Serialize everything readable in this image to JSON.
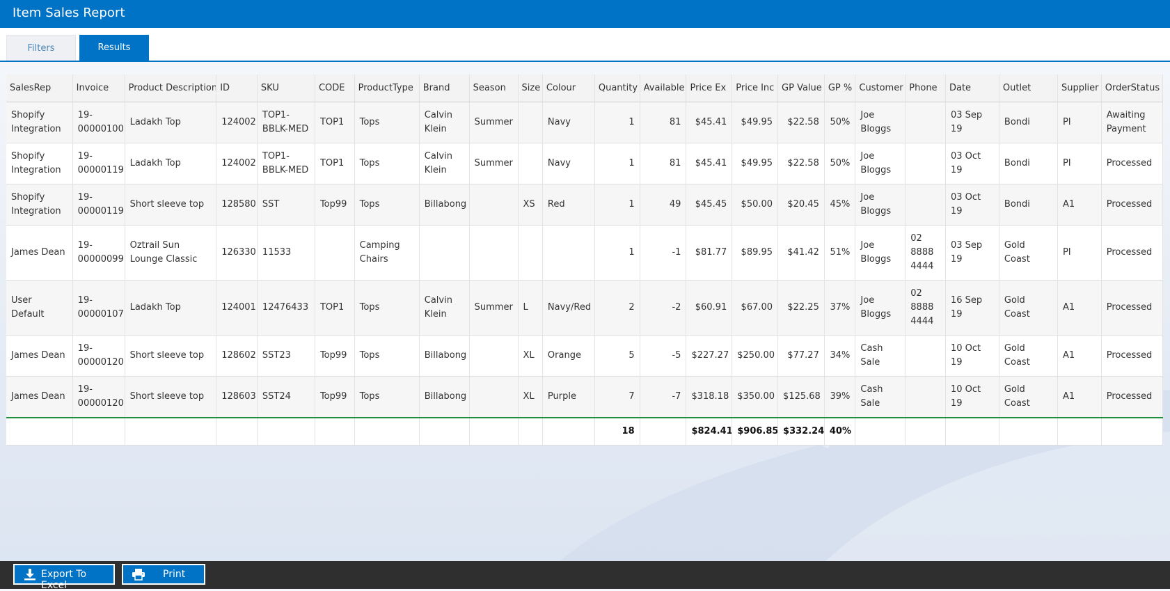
{
  "app": {
    "title": "Item Sales Report"
  },
  "tabs": [
    {
      "label": "Filters",
      "active": false
    },
    {
      "label": "Results",
      "active": true
    }
  ],
  "table": {
    "columns": [
      "SalesRep",
      "Invoice",
      "Product Description",
      "ID",
      "SKU",
      "CODE",
      "ProductType",
      "Brand",
      "Season",
      "Size",
      "Colour",
      "Quantity",
      "Available",
      "Price Ex",
      "Price Inc",
      "GP Value",
      "GP %",
      "Customer",
      "Phone",
      "Date",
      "Outlet",
      "Supplier",
      "OrderStatus"
    ],
    "rows": [
      [
        "Shopify Integration",
        "19-00000100",
        "Ladakh Top",
        "124002",
        "TOP1-BBLK-MED",
        "TOP1",
        "Tops",
        "Calvin Klein",
        "Summer",
        "",
        "Navy",
        "1",
        "81",
        "$45.41",
        "$49.95",
        "$22.58",
        "50%",
        "Joe Bloggs",
        "",
        "03 Sep 19",
        "Bondi",
        "PI",
        "Awaiting Payment"
      ],
      [
        "Shopify Integration",
        "19-00000119",
        "Ladakh Top",
        "124002",
        "TOP1-BBLK-MED",
        "TOP1",
        "Tops",
        "Calvin Klein",
        "Summer",
        "",
        "Navy",
        "1",
        "81",
        "$45.41",
        "$49.95",
        "$22.58",
        "50%",
        "Joe Bloggs",
        "",
        "03 Oct 19",
        "Bondi",
        "PI",
        "Processed"
      ],
      [
        "Shopify Integration",
        "19-00000119",
        "Short sleeve top",
        "128580",
        "SST",
        "Top99",
        "Tops",
        "Billabong",
        "",
        "XS",
        "Red",
        "1",
        "49",
        "$45.45",
        "$50.00",
        "$20.45",
        "45%",
        "Joe Bloggs",
        "",
        "03 Oct 19",
        "Bondi",
        "A1",
        "Processed"
      ],
      [
        "James Dean",
        "19-00000099",
        "Oztrail Sun Lounge Classic",
        "126330",
        "11533",
        "",
        "Camping Chairs",
        "",
        "",
        "",
        "",
        "1",
        "-1",
        "$81.77",
        "$89.95",
        "$41.42",
        "51%",
        "Joe Bloggs",
        "02 8888 4444",
        "03 Sep 19",
        "Gold Coast",
        "PI",
        "Processed"
      ],
      [
        "User Default",
        "19-00000107",
        "Ladakh Top",
        "124001",
        "12476433",
        "TOP1",
        "Tops",
        "Calvin Klein",
        "Summer",
        "L",
        "Navy/Red",
        "2",
        "-2",
        "$60.91",
        "$67.00",
        "$22.25",
        "37%",
        "Joe Bloggs",
        "02 8888 4444",
        "16 Sep 19",
        "Gold Coast",
        "A1",
        "Processed"
      ],
      [
        "James Dean",
        "19-00000120",
        "Short sleeve top",
        "128602",
        "SST23",
        "Top99",
        "Tops",
        "Billabong",
        "",
        "XL",
        "Orange",
        "5",
        "-5",
        "$227.27",
        "$250.00",
        "$77.27",
        "34%",
        "Cash Sale",
        "",
        "10 Oct 19",
        "Gold Coast",
        "A1",
        "Processed"
      ],
      [
        "James Dean",
        "19-00000120",
        "Short sleeve top",
        "128603",
        "SST24",
        "Top99",
        "Tops",
        "Billabong",
        "",
        "XL",
        "Purple",
        "7",
        "-7",
        "$318.18",
        "$350.00",
        "$125.68",
        "39%",
        "Cash Sale",
        "",
        "10 Oct 19",
        "Gold Coast",
        "A1",
        "Processed"
      ]
    ],
    "totals": [
      "",
      "",
      "",
      "",
      "",
      "",
      "",
      "",
      "",
      "",
      "",
      "18",
      "",
      "$824.41",
      "$906.85",
      "$332.24",
      "40%",
      "",
      "",
      "",
      "",
      "",
      ""
    ]
  },
  "toolbar": {
    "export_label": "Export To Excel",
    "print_label": "Print"
  },
  "icons": {
    "export": "download-icon",
    "print": "printer-icon"
  },
  "colors": {
    "accent": "#0073c6",
    "totals_rule": "#1f8f3a",
    "footer_bar": "#2f2f2f"
  }
}
